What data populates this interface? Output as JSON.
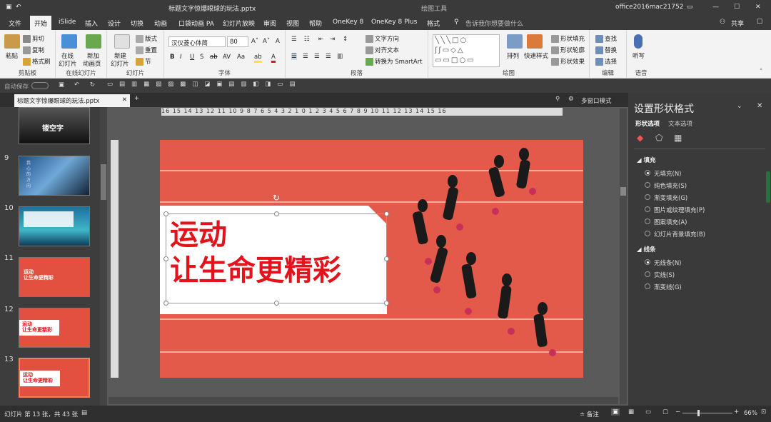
{
  "titlebar": {
    "tools_label": "绘图工具",
    "filename": "标题文字惊爆眼球的玩法.pptx",
    "account": "office2016mac21752"
  },
  "tabs": [
    "文件",
    "开始",
    "iSlide",
    "插入",
    "设计",
    "切换",
    "动画",
    "口袋动画 PA",
    "幻灯片放映",
    "审阅",
    "视图",
    "帮助",
    "OneKey 8",
    "OneKey 8 Plus",
    "格式"
  ],
  "active_tab": "开始",
  "search": {
    "placeholder": "告诉我你想要做什么"
  },
  "share": "共享",
  "ribbon": {
    "clipboard": {
      "label": "剪贴板",
      "paste": "粘贴",
      "cut": "剪切",
      "copy": "复制",
      "painter": "格式刷"
    },
    "online": {
      "label": "在线幻灯片",
      "a": "在线",
      "a2": "幻灯片",
      "b": "新加",
      "b2": "动画页"
    },
    "slides": {
      "label": "幻灯片",
      "new": "新建",
      "new2": "幻灯片",
      "layout": "版式",
      "reset": "重置",
      "section": "节"
    },
    "font": {
      "label": "字体",
      "name": "汉仪菱心体简",
      "size": "80"
    },
    "para": {
      "label": "段落",
      "dir": "文字方向",
      "align": "对齐文本",
      "smart": "转换为 SmartArt"
    },
    "draw": {
      "label": "绘图",
      "arrange": "排列",
      "quick": "快速样式",
      "fill": "形状填充",
      "outline": "形状轮廓",
      "effect": "形状效果"
    },
    "edit": {
      "label": "编辑",
      "find": "查找",
      "replace": "替换",
      "select": "选择"
    },
    "voice": {
      "label": "语音",
      "dictate": "听写"
    }
  },
  "qat": {
    "autosave": "自动保存"
  },
  "doctab": "标题文字惊爆眼球的玩法.pptx",
  "multiwin": "多窗口模式",
  "thumbs": [
    {
      "num": "9"
    },
    {
      "num": "10"
    },
    {
      "num": "11"
    },
    {
      "num": "12"
    },
    {
      "num": "13"
    }
  ],
  "thumb8_text": "镂空字",
  "thumb9_text": "我心的方向",
  "thumb_slide_text": [
    "运动",
    "让生命更精彩"
  ],
  "ruler_h": "16 15 14 13 12 11 10 9 8 7 6 5 4 3 2 1 0 1 2 3 4 5 6 7 8 9 10 11 12 13 14 15 16",
  "slide": {
    "line1": "运动",
    "line2": "让生命更精彩"
  },
  "panel": {
    "title": "设置形状格式",
    "tab1": "形状选项",
    "tab2": "文本选项",
    "fill": {
      "label": "填充",
      "options": [
        "无填充(N)",
        "纯色填充(S)",
        "渐变填充(G)",
        "图片或纹理填充(P)",
        "图案填充(A)",
        "幻灯片背景填充(B)"
      ],
      "selected": 0
    },
    "line": {
      "label": "线条",
      "options": [
        "无线条(N)",
        "实线(S)",
        "渐变线(G)"
      ],
      "selected": 0
    }
  },
  "status": {
    "slideinfo": "幻灯片 第 13 张，共 43 张",
    "notes": "备注",
    "zoom": "66%"
  },
  "colors": {
    "slide_bg": "#e35a4b",
    "accent_red": "#e3121b",
    "thumb_red": "#e4503f"
  }
}
